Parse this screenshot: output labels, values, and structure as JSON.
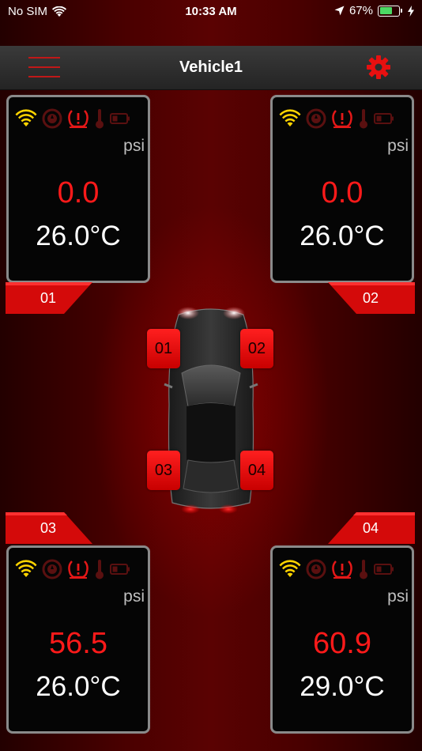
{
  "status_bar": {
    "carrier": "No SIM",
    "time": "10:33 AM",
    "battery_percent": "67%",
    "battery_level": 0.67
  },
  "nav": {
    "title": "Vehicle1"
  },
  "unit": "psi",
  "colors": {
    "accent": "#ff1a1a",
    "wifi": "#ffd400",
    "warning": "#e41818",
    "dim_icon": "#5a1010"
  },
  "tires": [
    {
      "id": "01",
      "pressure": "0.0",
      "temperature": "26.0°C"
    },
    {
      "id": "02",
      "pressure": "0.0",
      "temperature": "26.0°C"
    },
    {
      "id": "03",
      "pressure": "56.5",
      "temperature": "26.0°C"
    },
    {
      "id": "04",
      "pressure": "60.9",
      "temperature": "29.0°C"
    }
  ],
  "icons": [
    "wifi-icon",
    "tire-leak-icon",
    "tire-pressure-warning-icon",
    "thermometer-icon",
    "battery-icon"
  ]
}
